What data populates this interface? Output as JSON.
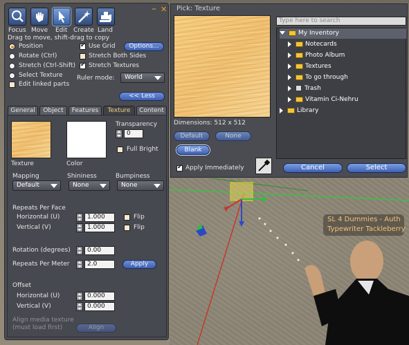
{
  "toolbar": {
    "tools": [
      {
        "label": "Focus",
        "icon": "magnifier-icon"
      },
      {
        "label": "Move",
        "icon": "hand-icon"
      },
      {
        "label": "Edit",
        "icon": "pointer-icon"
      },
      {
        "label": "Create",
        "icon": "wand-icon"
      },
      {
        "label": "Land",
        "icon": "bulldozer-icon"
      }
    ],
    "minimize": "–",
    "close": "✕",
    "hint": "Drag to move, shift-drag to copy"
  },
  "edit_options": {
    "position": "Position",
    "rotate": "Rotate (Ctrl)",
    "stretch": "Stretch (Ctrl-Shift)",
    "select_texture": "Select Texture",
    "edit_linked": "Edit linked parts",
    "use_grid": "Use Grid",
    "options_btn": "Options...",
    "stretch_both": "Stretch Both Sides",
    "stretch_textures": "Stretch Textures",
    "ruler_label": "Ruler mode:",
    "ruler_value": "World",
    "less_btn": "<< Less"
  },
  "tabs": [
    "General",
    "Object",
    "Features",
    "Texture",
    "Content"
  ],
  "texture_tab": {
    "texture_label": "Texture",
    "color_label": "Color",
    "transparency_label": "Transparency",
    "transparency_value": "0",
    "full_bright": "Full Bright",
    "mapping_label": "Mapping",
    "mapping_value": "Default",
    "shininess_label": "Shininess",
    "shininess_value": "None",
    "bumpiness_label": "Bumpiness",
    "bumpiness_value": "None",
    "repeats_per_face": "Repeats Per Face",
    "horizontal_u": "Horizontal (U)",
    "horizontal_u_value": "1.000",
    "vertical_v": "Vertical (V)",
    "vertical_v_value": "1.000",
    "flip": "Flip",
    "rotation_label": "Rotation (degrees)",
    "rotation_value": "0.00",
    "repeats_per_meter": "Repeats Per Meter",
    "repeats_per_meter_value": "2.0",
    "apply_btn": "Apply",
    "offset_label": "Offset",
    "offset_h_label": "Horizontal (U)",
    "offset_h_value": "0.000",
    "offset_v_label": "Vertical (V)",
    "offset_v_value": "0.000",
    "align_label_1": "Align media texture",
    "align_label_2": "(must load first)",
    "align_btn": "Align"
  },
  "pick_texture": {
    "title": "Pick: Texture",
    "dimensions": "Dimensions: 512 x 512",
    "default_btn": "Default",
    "none_btn": "None",
    "blank_btn": "Blank",
    "apply_immediately": "Apply Immediately",
    "search_placeholder": "Type here to search",
    "cancel_btn": "Cancel",
    "select_btn": "Select",
    "inventory": {
      "root": "My Inventory",
      "items": [
        "Notecards",
        "Photo Album",
        "Textures",
        "To go through",
        "Trash",
        "Vitamin Ci-Nehru"
      ],
      "library": "Library"
    }
  },
  "world": {
    "nametag_line1": "SL 4 Dummies - Auth",
    "nametag_line2": "Typewriter Tackleberry"
  },
  "colors": {
    "panel": "#4a4c52",
    "button": "#4f6fc0",
    "active_tab_text": "#f0d28a",
    "wood": "#f2c674"
  }
}
